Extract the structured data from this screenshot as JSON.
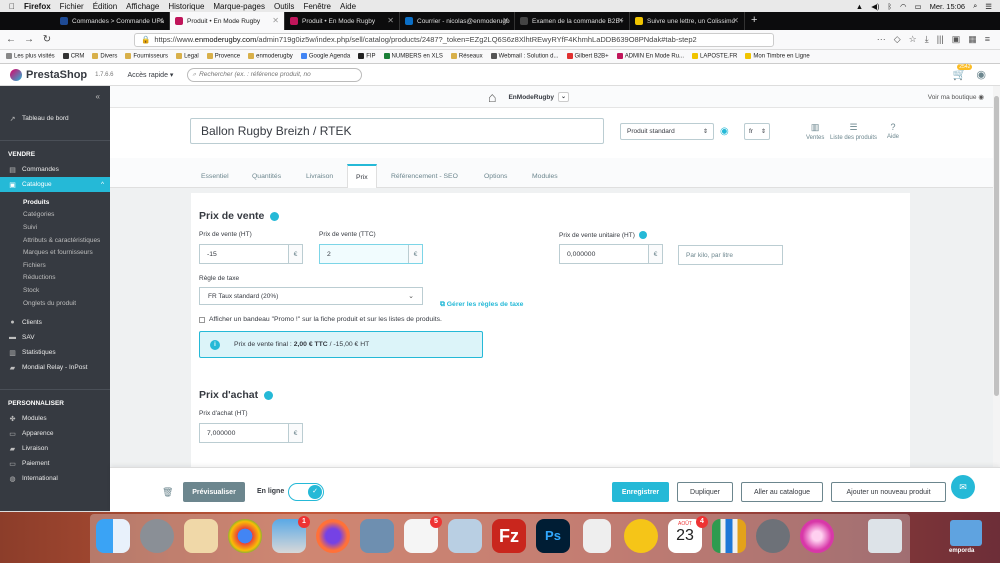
{
  "menubar": {
    "app": "Firefox",
    "items": [
      "Fichier",
      "Édition",
      "Affichage",
      "Historique",
      "Marque-pages",
      "Outils",
      "Fenêtre",
      "Aide"
    ],
    "clock": "Mer. 15:06"
  },
  "tabs": [
    {
      "label": "Commandes > Commande UFa",
      "color": "#1e4a94"
    },
    {
      "label": "Produit • En Mode Rugby",
      "color": "#c0155a"
    },
    {
      "label": "Produit • En Mode Rugby",
      "color": "#c0155a"
    },
    {
      "label": "Courrier - nicolas@enmoderugb",
      "color": "#0b6fc6"
    },
    {
      "label": "Examen de la commande B2B+",
      "color": "#222222"
    },
    {
      "label": "Suivre une lettre, un Colissimo",
      "color": "#f0c400"
    }
  ],
  "url": {
    "prefix": "https://www.",
    "host": "enmoderugby.com",
    "rest": "/admin719g0iz5w/index.php/sell/catalog/products/2487?_token=EZg2LQ6S6z8XlhtREwyRYfF4KhmhLaDDB639O8PNdak#tab-step2"
  },
  "bookmarks": [
    "Les plus visités",
    "CRM",
    "Divers",
    "Fournisseurs",
    "Legal",
    "Provence",
    "enmoderugby",
    "Google Agenda",
    "FIP",
    "NUMBERS en XLS",
    "Réseaux",
    "Webmail : Solution d...",
    "Gilbert B2B+",
    "ADMIN En Mode Ru...",
    "LAPOSTE.FR",
    "Mon Timbre en Ligne"
  ],
  "header": {
    "logo": "PrestaShop",
    "version": "1.7.6.6",
    "quick": "Accès rapide ▾",
    "search_placeholder": "Rechercher (ex. : référence produit, no",
    "notif_count": "2542"
  },
  "sidebar": {
    "top": "Tableau de bord",
    "vendre": "VENDRE",
    "commandes": "Commandes",
    "catalogue": "Catalogue",
    "sub": [
      "Produits",
      "Catégories",
      "Suivi",
      "Attributs & caractéristiques",
      "Marques et fournisseurs",
      "Fichiers",
      "Réductions",
      "Stock",
      "Onglets du produit"
    ],
    "clients": "Clients",
    "sav": "SAV",
    "stats": "Statistiques",
    "mondial": "Mondial Relay - InPost",
    "perso": "PERSONNALISER",
    "modules": "Modules",
    "apparence": "Apparence",
    "livraison": "Livraison",
    "paiement": "Paiement",
    "international": "International"
  },
  "shop": {
    "name": "EnModeRugby",
    "voir": "Voir ma boutique"
  },
  "product": {
    "name": "Ballon Rugby Breizh / RTEK",
    "type": "Produit standard",
    "lang": "fr",
    "actions": {
      "ventes": "Ventes",
      "liste": "Liste des produits",
      "aide": "Aide"
    }
  },
  "ptabs": [
    "Essentiel",
    "Quantités",
    "Livraison",
    "Prix",
    "Référencement - SEO",
    "Options",
    "Modules"
  ],
  "prix": {
    "title": "Prix de vente",
    "ht_label": "Prix de vente (HT)",
    "ht_value": "-15",
    "ttc_label": "Prix de vente (TTC)",
    "ttc_value": "2",
    "unit_label": "Prix de vente unitaire (HT)",
    "unit_value": "0,000000",
    "unit_placeholder": "Par kilo, par litre",
    "currency": "€",
    "tax_label": "Règle de taxe",
    "tax_value": "FR Taux standard (20%)",
    "tax_link": "Gérer les règles de taxe",
    "promo": "Afficher un bandeau \"Promo !\" sur la fiche produit et sur les listes de produits.",
    "final_prefix": "Prix de vente final :",
    "final_ttc": "2,00 € TTC",
    "final_ht": "/ -15,00 € HT"
  },
  "achat": {
    "title": "Prix d'achat",
    "label": "Prix d'achat (HT)",
    "value": "7,000000"
  },
  "footer": {
    "preview": "Prévisualiser",
    "online": "En ligne",
    "save": "Enregistrer",
    "dup": "Dupliquer",
    "catalog": "Aller au catalogue",
    "add": "Ajouter un nouveau produit"
  },
  "dock": {
    "mail_badge": "1",
    "reminders_badge": "5",
    "cal_badge": "4",
    "cal_month": "AOÛT",
    "cal_day": "23",
    "folder": "emporda"
  }
}
